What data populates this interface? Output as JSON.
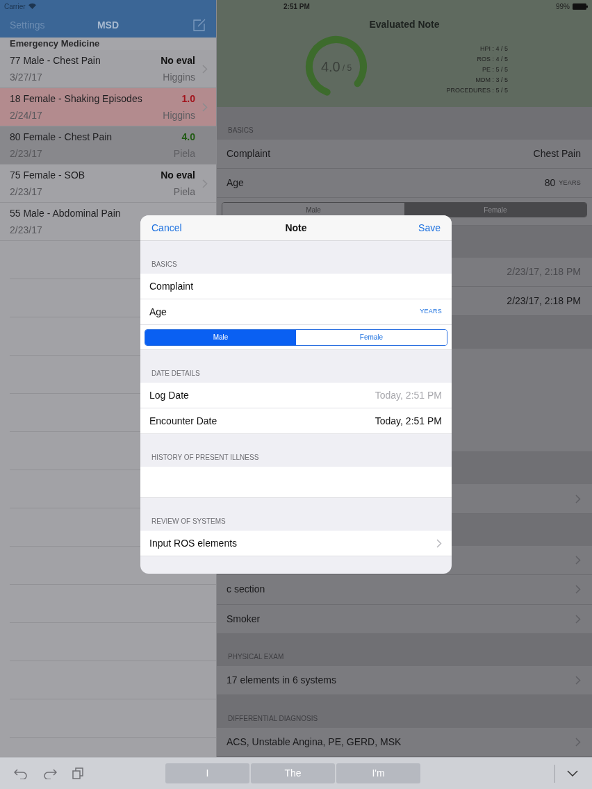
{
  "status_bar": {
    "carrier": "Carrier",
    "time": "2:51 PM",
    "battery": "99%"
  },
  "sidebar": {
    "nav_left": "Settings",
    "nav_title": "MSD",
    "section": "Emergency Medicine",
    "items": [
      {
        "title": "77 Male - Chest Pain",
        "date": "3/27/17",
        "score": "No eval",
        "color": "#111111",
        "author": "Higgins",
        "flagged": false,
        "selected": false,
        "chevron": true
      },
      {
        "title": "18 Female - Shaking Episodes",
        "date": "2/24/17",
        "score": "1.0",
        "color": "#a3141c",
        "author": "Higgins",
        "flagged": true,
        "selected": false,
        "chevron": true
      },
      {
        "title": "80 Female - Chest Pain",
        "date": "2/23/17",
        "score": "4.0",
        "color": "#1f5a12",
        "author": "Piela",
        "flagged": false,
        "selected": true,
        "chevron": false
      },
      {
        "title": "75 Female - SOB",
        "date": "2/23/17",
        "score": "No eval",
        "color": "#111111",
        "author": "Piela",
        "flagged": false,
        "selected": false,
        "chevron": true
      },
      {
        "title": "55 Male - Abdominal Pain",
        "date": "2/23/17",
        "flagged": false,
        "selected": false
      }
    ]
  },
  "detail": {
    "title": "Evaluated Note",
    "score": "4.0",
    "score_max": "/ 5",
    "level": 0.8,
    "scores": [
      "HPI : 4 / 5",
      "ROS : 4 / 5",
      "PE : 5 / 5",
      "MDM : 3 / 5",
      "PROCEDURES : 5 / 5"
    ],
    "items": [
      {
        "kind": "header",
        "label": "BASICS"
      },
      {
        "kind": "row",
        "label": "Complaint",
        "value": "Chest Pain"
      },
      {
        "kind": "row",
        "label": "Age",
        "value": "80",
        "unit": "YEARS"
      },
      {
        "kind": "segment",
        "options": [
          {
            "label": "Male",
            "selected": false
          },
          {
            "label": "Female",
            "selected": true
          }
        ]
      },
      {
        "kind": "header"
      },
      {
        "kind": "row",
        "value": "2/23/17, 2:18 PM",
        "muted": true
      },
      {
        "kind": "row",
        "value": "2/23/17, 2:18 PM"
      },
      {
        "kind": "header"
      },
      {
        "kind": "textarea"
      },
      {
        "kind": "header"
      },
      {
        "kind": "row",
        "chevron": true
      },
      {
        "kind": "header"
      },
      {
        "kind": "row",
        "chevron": true
      },
      {
        "kind": "row",
        "label": "c section",
        "chevron": true
      },
      {
        "kind": "row",
        "label": "Smoker",
        "chevron": true
      },
      {
        "kind": "header",
        "label": "PHYSICAL EXAM"
      },
      {
        "kind": "row",
        "label": "17 elements in 6 systems",
        "chevron": true
      },
      {
        "kind": "header",
        "label": "DIFFERENTIAL DIAGNOSIS"
      },
      {
        "kind": "row",
        "label": "ACS, Unstable Angina, PE, GERD, MSK",
        "chevron": true
      }
    ]
  },
  "modal": {
    "cancel": "Cancel",
    "title": "Note",
    "save": "Save",
    "items": [
      {
        "kind": "header",
        "label": "BASICS"
      },
      {
        "kind": "row",
        "label": "Complaint"
      },
      {
        "kind": "row",
        "label": "Age",
        "unit": "YEARS"
      },
      {
        "kind": "segment",
        "options": [
          {
            "label": "Male",
            "selected": true
          },
          {
            "label": "Female",
            "selected": false
          }
        ]
      },
      {
        "kind": "header",
        "label": "DATE DETAILS"
      },
      {
        "kind": "row",
        "label": "Log Date",
        "value": "Today, 2:51 PM",
        "muted": true
      },
      {
        "kind": "row",
        "label": "Encounter Date",
        "value": "Today, 2:51 PM"
      },
      {
        "kind": "header",
        "label": "HISTORY OF PRESENT ILLNESS"
      },
      {
        "kind": "textarea"
      },
      {
        "kind": "header",
        "label": "REVIEW OF SYSTEMS"
      },
      {
        "kind": "row",
        "label": "Input ROS elements",
        "chevron": true
      }
    ]
  },
  "keyboard": {
    "suggestions": [
      "I",
      "The",
      "I'm"
    ]
  }
}
